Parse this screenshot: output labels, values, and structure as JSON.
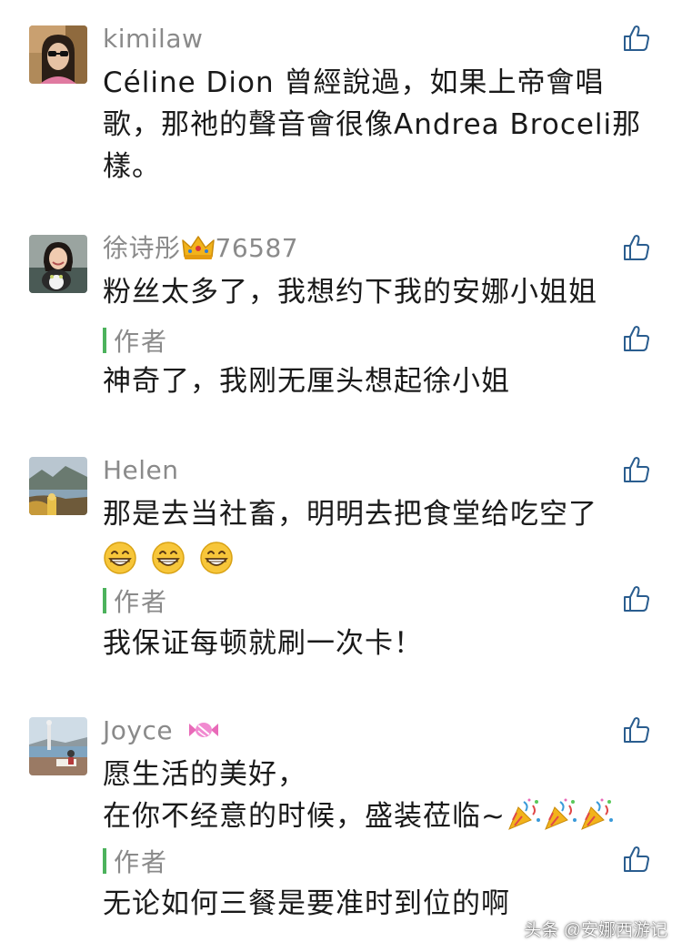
{
  "comments": [
    {
      "username": "kimilaw",
      "text_lines": [
        "Céline Dion 曾經說過，如果上帝會唱",
        "歌，那祂的聲音會很像Andrea Broceli那",
        "樣。"
      ]
    },
    {
      "username_prefix": "徐诗彤",
      "username_suffix": "76587",
      "username_emoji": "crown-emoji",
      "text": "粉丝太多了，我想约下我的安娜小姐姐",
      "reply": {
        "author_label": "作者",
        "text": "神奇了，我刚无厘头想起徐小姐"
      }
    },
    {
      "username": "Helen",
      "text": "那是去当社畜，明明去把食堂给吃空了",
      "text_emoji": "grinning-face-emoji",
      "text_emoji_count": 3,
      "reply": {
        "author_label": "作者",
        "text": "我保证每顿就刷一次卡！"
      }
    },
    {
      "username": "Joyce",
      "username_emoji": "candy-emoji",
      "text_lines": [
        "愿生活的美好，",
        "在你不经意的时候，盛装莅临~"
      ],
      "text_emoji": "party-popper-emoji",
      "text_emoji_count": 3,
      "reply": {
        "author_label": "作者",
        "text": "无论如何三餐是要准时到位的啊"
      }
    }
  ],
  "watermark": "头条 @安娜西游记",
  "colors": {
    "username": "#8a8a8a",
    "author_bar": "#4cb25c",
    "like_icon": "#2a5d8f",
    "text": "#1a1a1a"
  },
  "icons": {
    "like": "thumbs-up-icon"
  }
}
